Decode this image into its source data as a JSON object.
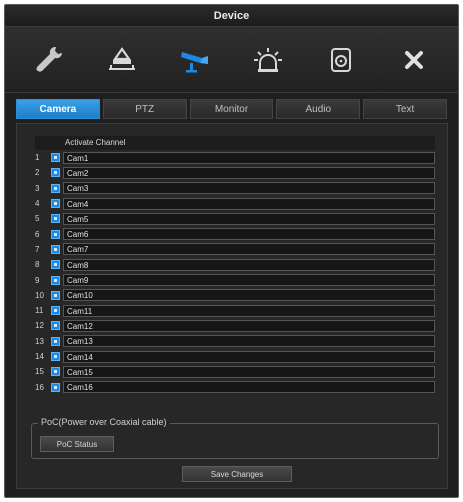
{
  "window": {
    "title": "Device"
  },
  "toolbar": {
    "items": [
      {
        "icon": "wrench-icon",
        "active": false
      },
      {
        "icon": "network-icon",
        "active": false
      },
      {
        "icon": "camera-icon",
        "active": true
      },
      {
        "icon": "alarm-icon",
        "active": false
      },
      {
        "icon": "storage-icon",
        "active": false
      },
      {
        "icon": "close-icon",
        "active": false
      }
    ],
    "accent_color": "#1e88e5"
  },
  "tabs": [
    {
      "label": "Camera",
      "active": true
    },
    {
      "label": "PTZ",
      "active": false
    },
    {
      "label": "Monitor",
      "active": false
    },
    {
      "label": "Audio",
      "active": false
    },
    {
      "label": "Text",
      "active": false
    }
  ],
  "channels": {
    "header": "Activate Channel",
    "rows": [
      {
        "num": "1",
        "name": "Cam1",
        "checked": true
      },
      {
        "num": "2",
        "name": "Cam2",
        "checked": true
      },
      {
        "num": "3",
        "name": "Cam3",
        "checked": true
      },
      {
        "num": "4",
        "name": "Cam4",
        "checked": true
      },
      {
        "num": "5",
        "name": "Cam5",
        "checked": true
      },
      {
        "num": "6",
        "name": "Cam6",
        "checked": true
      },
      {
        "num": "7",
        "name": "Cam7",
        "checked": true
      },
      {
        "num": "8",
        "name": "Cam8",
        "checked": true
      },
      {
        "num": "9",
        "name": "Cam9",
        "checked": true
      },
      {
        "num": "10",
        "name": "Cam10",
        "checked": true
      },
      {
        "num": "11",
        "name": "Cam11",
        "checked": true
      },
      {
        "num": "12",
        "name": "Cam12",
        "checked": true
      },
      {
        "num": "13",
        "name": "Cam13",
        "checked": true
      },
      {
        "num": "14",
        "name": "Cam14",
        "checked": true
      },
      {
        "num": "15",
        "name": "Cam15",
        "checked": true
      },
      {
        "num": "16",
        "name": "Cam16",
        "checked": true
      }
    ]
  },
  "poc": {
    "legend": "PoC(Power over Coaxial cable)",
    "button_label": "PoC Status"
  },
  "footer": {
    "save_label": "Save Changes"
  }
}
